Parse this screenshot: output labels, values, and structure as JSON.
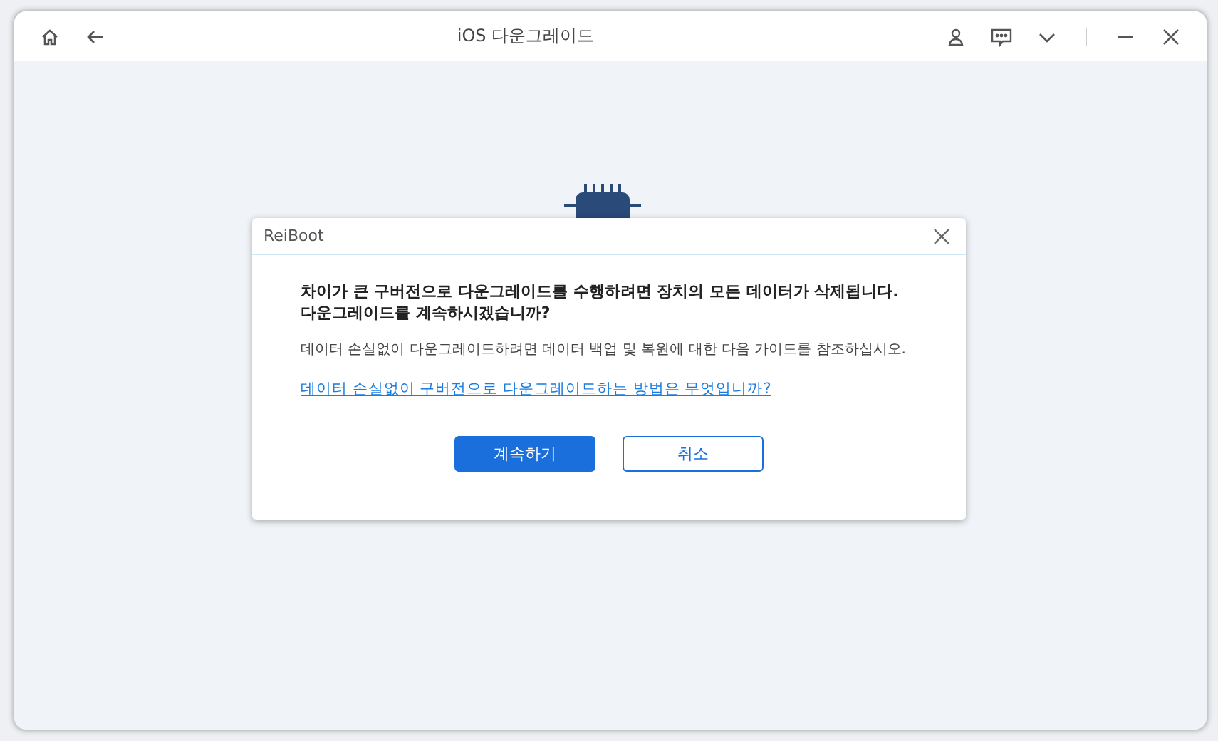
{
  "window": {
    "title": "iOS 다운그레이드"
  },
  "dialog": {
    "title": "ReiBoot",
    "warning": "차이가 큰 구버전으로 다운그레이드를 수행하려면 장치의 모든 데이터가 삭제됩니다. 다운그레이드를 계속하시겠습니까?",
    "note": "데이터 손실없이 다운그레이드하려면 데이터 백업 및 복원에 대한 다음 가이드를 참조하십시오.",
    "link": "데이터 손실없이 구버전으로 다운그레이드하는 방법은 무엇입니까?",
    "buttons": [
      {
        "label": "계속하기",
        "kind": "primary"
      },
      {
        "label": "취소",
        "kind": "secondary"
      }
    ]
  }
}
